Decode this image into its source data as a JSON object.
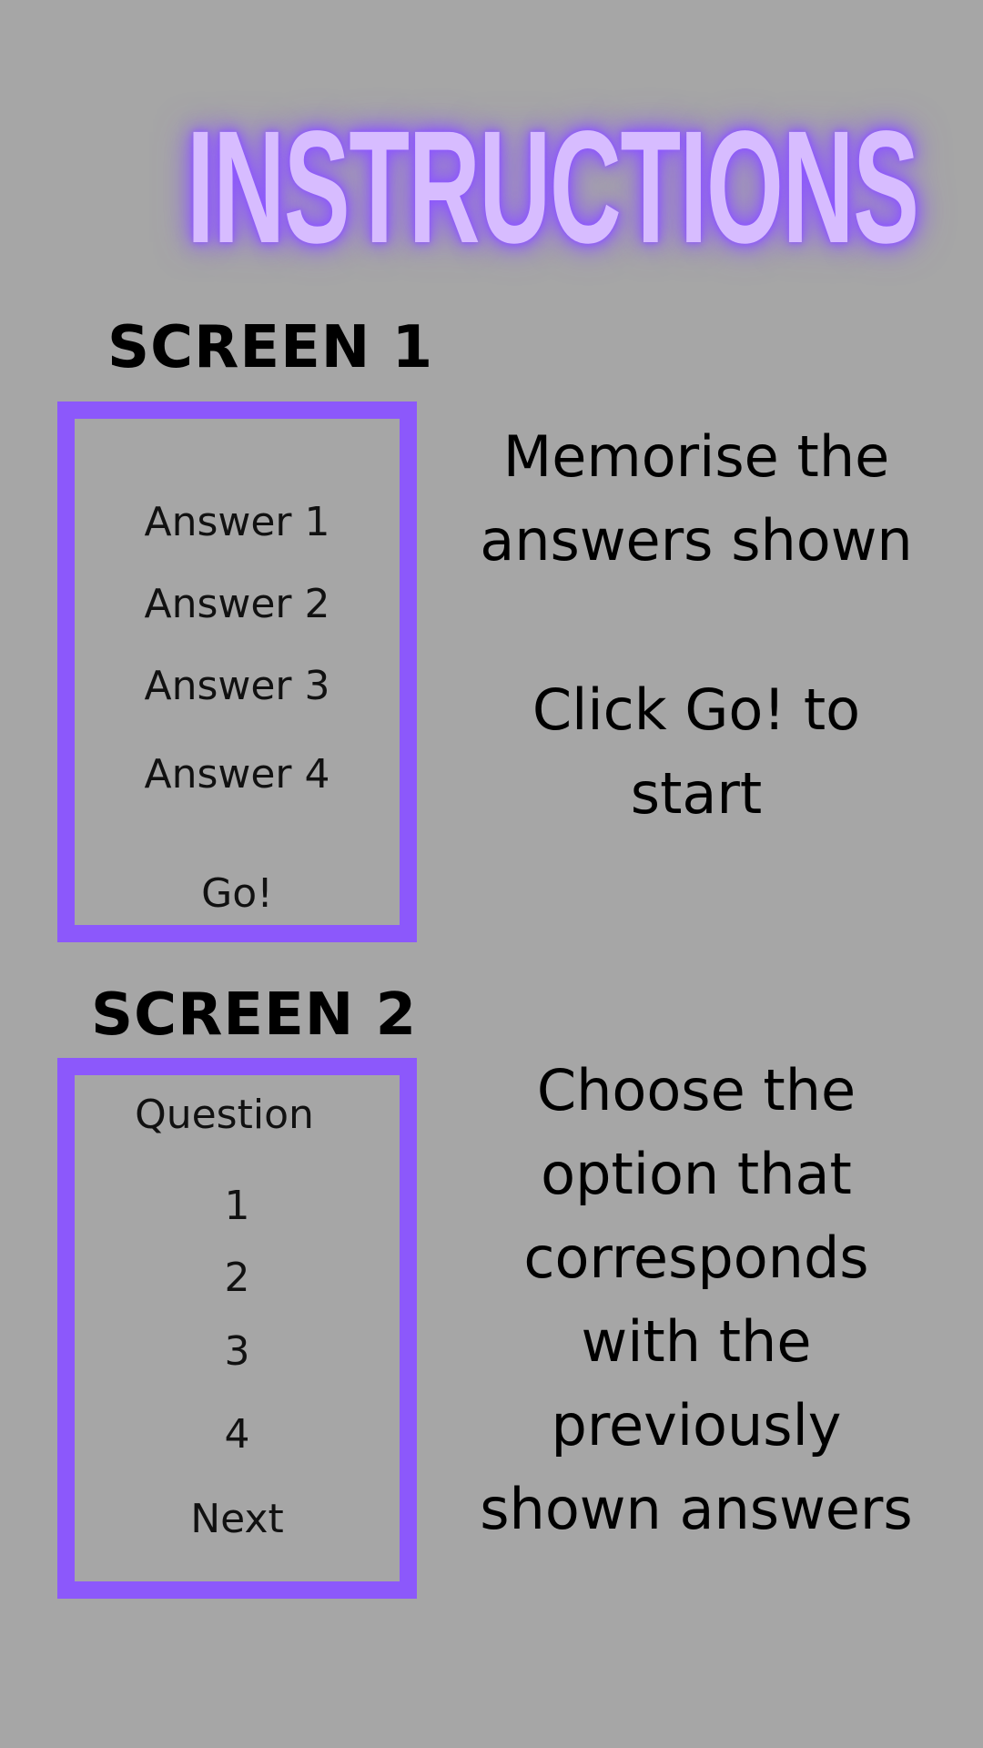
{
  "title": "INSTRUCTIONS",
  "screen1": {
    "label": "SCREEN 1",
    "answers": [
      "Answer 1",
      "Answer 2",
      "Answer 3",
      "Answer 4"
    ],
    "button_label": "Go!",
    "instruction_1": "Memorise the answers shown",
    "instruction_2": "Click Go! to start"
  },
  "screen2": {
    "label": "SCREEN 2",
    "question": "Question",
    "options": [
      "1",
      "2",
      "3",
      "4"
    ],
    "button_label": "Next",
    "instruction": "Choose the option that corresponds with the previously shown answers"
  },
  "colors": {
    "background": "#a6a6a6",
    "accent": "#8c58fb",
    "title_fill": "#d7bcff"
  }
}
